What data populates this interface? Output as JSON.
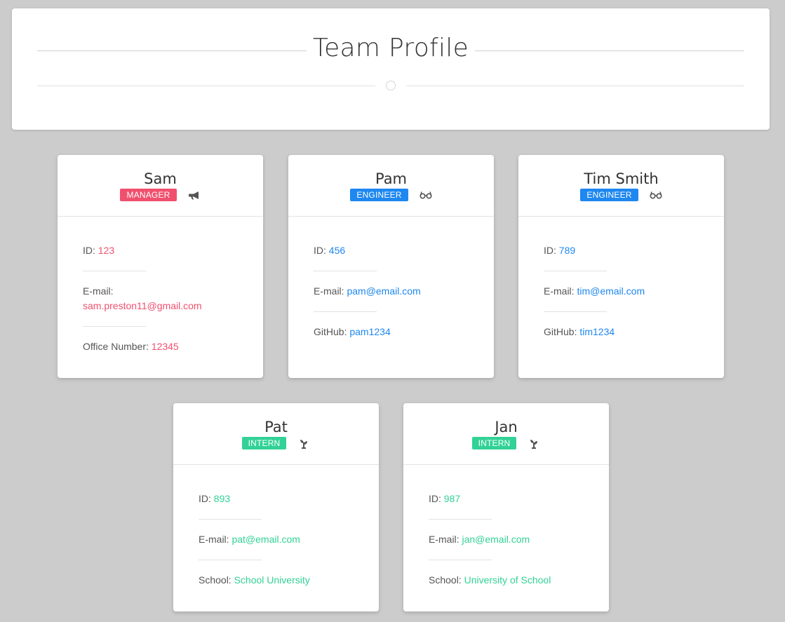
{
  "page": {
    "title": "Team Profile"
  },
  "colors": {
    "manager": "#f0506e",
    "engineer": "#1e87f0",
    "intern": "#32d296",
    "background": "#cccccc"
  },
  "cards": [
    {
      "name": "Sam",
      "role": "MANAGER",
      "icon": "megaphone-icon",
      "fields": [
        {
          "label": "ID: ",
          "value": "123"
        },
        {
          "label": "E-mail: ",
          "value": "sam.preston11@gmail.com"
        },
        {
          "label": "Office Number: ",
          "value": "12345"
        }
      ]
    },
    {
      "name": "Pam",
      "role": "ENGINEER",
      "icon": "glasses-icon",
      "fields": [
        {
          "label": "ID: ",
          "value": "456"
        },
        {
          "label": "E-mail: ",
          "value": "pam@email.com"
        },
        {
          "label": "GitHub: ",
          "value": "pam1234"
        }
      ]
    },
    {
      "name": "Tim Smith",
      "role": "ENGINEER",
      "icon": "glasses-icon",
      "fields": [
        {
          "label": "ID: ",
          "value": "789"
        },
        {
          "label": "E-mail: ",
          "value": "tim@email.com"
        },
        {
          "label": "GitHub: ",
          "value": "tim1234"
        }
      ]
    },
    {
      "name": "Pat",
      "role": "INTERN",
      "icon": "seedling-icon",
      "fields": [
        {
          "label": "ID: ",
          "value": "893"
        },
        {
          "label": "E-mail: ",
          "value": "pat@email.com"
        },
        {
          "label": "School: ",
          "value": "School University"
        }
      ]
    },
    {
      "name": "Jan",
      "role": "INTERN",
      "icon": "seedling-icon",
      "fields": [
        {
          "label": "ID: ",
          "value": "987"
        },
        {
          "label": "E-mail: ",
          "value": "jan@email.com"
        },
        {
          "label": "School: ",
          "value": "University of School"
        }
      ]
    }
  ]
}
